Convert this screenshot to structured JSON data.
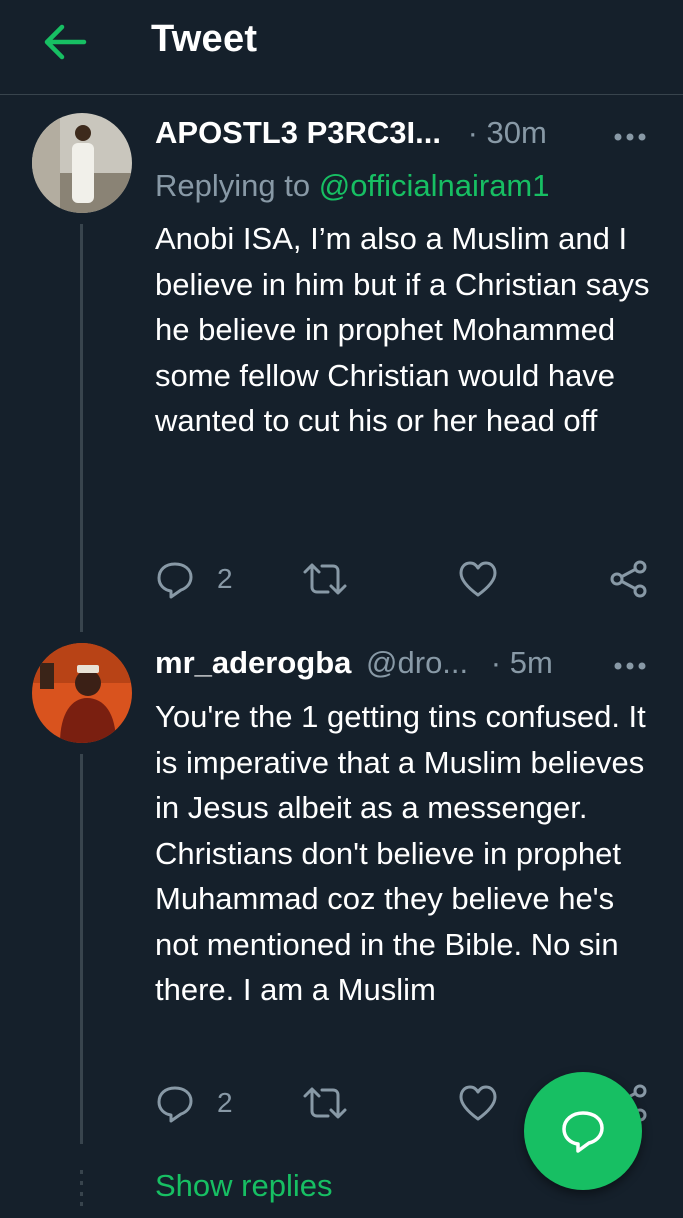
{
  "header": {
    "title": "Tweet"
  },
  "colors": {
    "background": "#15202b",
    "accent": "#17bf63",
    "muted": "#8899a6",
    "divider": "#38444d"
  },
  "tweets": [
    {
      "name": "APOSTL3 P3RC3I...",
      "time": "· 30m",
      "replying_prefix": "Replying to",
      "replying_to": "@officialnairam1",
      "text": "Anobi ISA, I’m also a Muslim and I believe in him but if a Christian says he believe in prophet Mohammed some fellow Christian would have wanted to cut his or her head off",
      "reply_count": "2"
    },
    {
      "name": "mr_aderogba",
      "handle": "@dro...",
      "time": "· 5m",
      "text": "You're the 1 getting tins confused. It is imperative that a Muslim believes in Jesus albeit as a messenger. Christians don't believe in prophet Muhammad coz they believe he's not mentioned in the Bible. No sin there. I am a Muslim",
      "reply_count": "2"
    }
  ],
  "show_replies": "Show replies",
  "icons": [
    "back-arrow-icon",
    "more-icon",
    "reply-icon",
    "retweet-icon",
    "like-icon",
    "share-icon",
    "compose-reply-icon"
  ]
}
